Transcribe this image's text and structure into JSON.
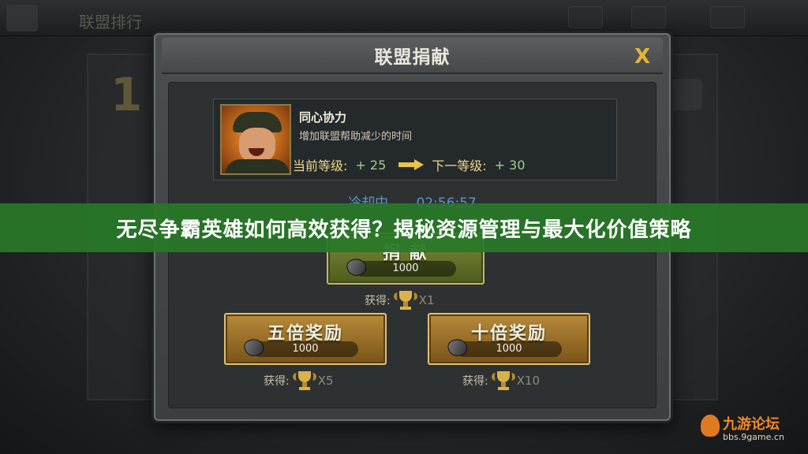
{
  "background": {
    "topbar_title": "联盟排行",
    "rank_number": "1"
  },
  "dialog": {
    "title": "联盟捐献",
    "close_label": "X",
    "skill": {
      "name": "同心协力",
      "description": "增加联盟帮助减少的时间",
      "current_level_label": "当前等级:",
      "current_level_value": "+ 25",
      "next_level_label": "下一等级:",
      "next_level_value": "+ 30"
    },
    "cooldown": {
      "label": "冷却中",
      "time": "02:56:57"
    },
    "donate": {
      "label": "捐 献",
      "cost": "1000",
      "reward_label": "获得:",
      "reward_mult": "X1"
    },
    "five_times": {
      "label": "五倍奖励",
      "cost": "1000",
      "reward_label": "获得:",
      "reward_mult": "X5"
    },
    "ten_times": {
      "label": "十倍奖励",
      "cost": "1000",
      "reward_label": "获得:",
      "reward_mult": "X10"
    }
  },
  "banner": {
    "text": "无尽争霸英雄如何高效获得？揭秘资源管理与最大化价值策略"
  },
  "watermark": {
    "title": "九游论坛",
    "url": "bbs.9game.cn"
  },
  "colors": {
    "banner_bg": "#2e7a2e",
    "green_button": "#6a7a2e",
    "gold_button": "#a67a30",
    "level_value": "#9ed18a",
    "cooldown_text": "#5c96c9",
    "close_x": "#e4b43a"
  }
}
